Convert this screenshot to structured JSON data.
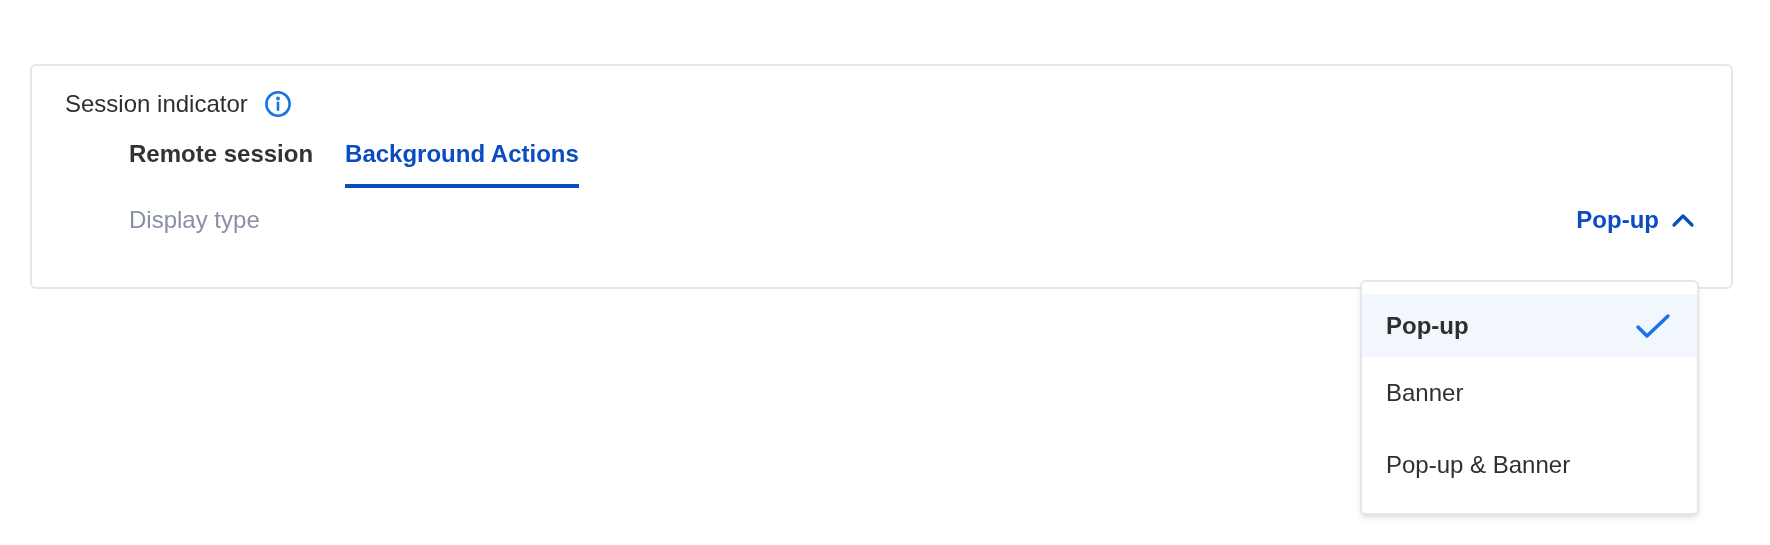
{
  "section": {
    "title": "Session indicator"
  },
  "tabs": [
    {
      "label": "Remote session",
      "selected": false
    },
    {
      "label": "Background Actions",
      "selected": true
    }
  ],
  "setting": {
    "label": "Display type",
    "value": "Pop-up",
    "expanded": true
  },
  "menu": [
    {
      "label": "Pop-up",
      "selected": true
    },
    {
      "label": "Banner",
      "selected": false
    },
    {
      "label": "Pop-up & Banner",
      "selected": false
    }
  ]
}
